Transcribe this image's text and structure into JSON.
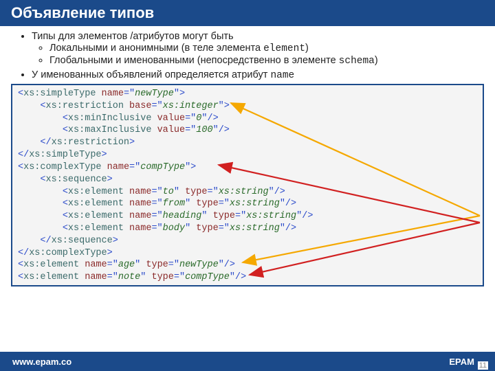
{
  "title": "Объявление типов",
  "bullets": {
    "item1": "Типы для элементов /атрибутов могут быть",
    "sub1": "Локальными и анонимными (в теле элемента ",
    "sub1_mono": "element",
    "sub1_end": ")",
    "sub2": "Глобальными и именованными (непосредственно в элементе ",
    "sub2_mono": "schema",
    "sub2_end": ")",
    "item2_a": "У именованных объявлений определяется атрибут ",
    "item2_mono": "name"
  },
  "code": [
    [
      {
        "t": "<",
        "c": "punct"
      },
      {
        "t": "xs:simpleType",
        "c": "tag"
      },
      {
        "t": " "
      },
      {
        "t": "name",
        "c": "attr"
      },
      {
        "t": "=\"",
        "c": "punct"
      },
      {
        "t": "newType",
        "c": "val"
      },
      {
        "t": "\">",
        "c": "punct"
      }
    ],
    [
      {
        "t": "    "
      },
      {
        "t": "<",
        "c": "punct"
      },
      {
        "t": "xs:restriction",
        "c": "tag"
      },
      {
        "t": " "
      },
      {
        "t": "base",
        "c": "attr"
      },
      {
        "t": "=\"",
        "c": "punct"
      },
      {
        "t": "xs:integer",
        "c": "val"
      },
      {
        "t": "\">",
        "c": "punct"
      }
    ],
    [
      {
        "t": "        "
      },
      {
        "t": "<",
        "c": "punct"
      },
      {
        "t": "xs:minInclusive",
        "c": "tag"
      },
      {
        "t": " "
      },
      {
        "t": "value",
        "c": "attr"
      },
      {
        "t": "=\"",
        "c": "punct"
      },
      {
        "t": "0",
        "c": "val"
      },
      {
        "t": "\"/>",
        "c": "punct"
      }
    ],
    [
      {
        "t": "        "
      },
      {
        "t": "<",
        "c": "punct"
      },
      {
        "t": "xs:maxInclusive",
        "c": "tag"
      },
      {
        "t": " "
      },
      {
        "t": "value",
        "c": "attr"
      },
      {
        "t": "=\"",
        "c": "punct"
      },
      {
        "t": "100",
        "c": "val"
      },
      {
        "t": "\"/>",
        "c": "punct"
      }
    ],
    [
      {
        "t": "    "
      },
      {
        "t": "</",
        "c": "punct"
      },
      {
        "t": "xs:restriction",
        "c": "tag"
      },
      {
        "t": ">",
        "c": "punct"
      }
    ],
    [
      {
        "t": "</",
        "c": "punct"
      },
      {
        "t": "xs:simpleType",
        "c": "tag"
      },
      {
        "t": ">",
        "c": "punct"
      }
    ],
    [
      {
        "t": "<",
        "c": "punct"
      },
      {
        "t": "xs:complexType",
        "c": "tag"
      },
      {
        "t": " "
      },
      {
        "t": "name",
        "c": "attr"
      },
      {
        "t": "=\"",
        "c": "punct"
      },
      {
        "t": "compType",
        "c": "val"
      },
      {
        "t": "\">",
        "c": "punct"
      }
    ],
    [
      {
        "t": "    "
      },
      {
        "t": "<",
        "c": "punct"
      },
      {
        "t": "xs:sequence",
        "c": "tag"
      },
      {
        "t": ">",
        "c": "punct"
      }
    ],
    [
      {
        "t": "        "
      },
      {
        "t": "<",
        "c": "punct"
      },
      {
        "t": "xs:element",
        "c": "tag"
      },
      {
        "t": " "
      },
      {
        "t": "name",
        "c": "attr"
      },
      {
        "t": "=\"",
        "c": "punct"
      },
      {
        "t": "to",
        "c": "val"
      },
      {
        "t": "\"",
        "c": "punct"
      },
      {
        "t": " "
      },
      {
        "t": "type",
        "c": "attr"
      },
      {
        "t": "=\"",
        "c": "punct"
      },
      {
        "t": "xs:string",
        "c": "val"
      },
      {
        "t": "\"/>",
        "c": "punct"
      }
    ],
    [
      {
        "t": "        "
      },
      {
        "t": "<",
        "c": "punct"
      },
      {
        "t": "xs:element",
        "c": "tag"
      },
      {
        "t": " "
      },
      {
        "t": "name",
        "c": "attr"
      },
      {
        "t": "=\"",
        "c": "punct"
      },
      {
        "t": "from",
        "c": "val"
      },
      {
        "t": "\"",
        "c": "punct"
      },
      {
        "t": " "
      },
      {
        "t": "type",
        "c": "attr"
      },
      {
        "t": "=\"",
        "c": "punct"
      },
      {
        "t": "xs:string",
        "c": "val"
      },
      {
        "t": "\"/>",
        "c": "punct"
      }
    ],
    [
      {
        "t": "        "
      },
      {
        "t": "<",
        "c": "punct"
      },
      {
        "t": "xs:element",
        "c": "tag"
      },
      {
        "t": " "
      },
      {
        "t": "name",
        "c": "attr"
      },
      {
        "t": "=\"",
        "c": "punct"
      },
      {
        "t": "heading",
        "c": "val"
      },
      {
        "t": "\"",
        "c": "punct"
      },
      {
        "t": " "
      },
      {
        "t": "type",
        "c": "attr"
      },
      {
        "t": "=\"",
        "c": "punct"
      },
      {
        "t": "xs:string",
        "c": "val"
      },
      {
        "t": "\"/>",
        "c": "punct"
      }
    ],
    [
      {
        "t": "        "
      },
      {
        "t": "<",
        "c": "punct"
      },
      {
        "t": "xs:element",
        "c": "tag"
      },
      {
        "t": " "
      },
      {
        "t": "name",
        "c": "attr"
      },
      {
        "t": "=\"",
        "c": "punct"
      },
      {
        "t": "body",
        "c": "val"
      },
      {
        "t": "\"",
        "c": "punct"
      },
      {
        "t": " "
      },
      {
        "t": "type",
        "c": "attr"
      },
      {
        "t": "=\"",
        "c": "punct"
      },
      {
        "t": "xs:string",
        "c": "val"
      },
      {
        "t": "\"/>",
        "c": "punct"
      }
    ],
    [
      {
        "t": "    "
      },
      {
        "t": "</",
        "c": "punct"
      },
      {
        "t": "xs:sequence",
        "c": "tag"
      },
      {
        "t": ">",
        "c": "punct"
      }
    ],
    [
      {
        "t": "</",
        "c": "punct"
      },
      {
        "t": "xs:complexType",
        "c": "tag"
      },
      {
        "t": ">",
        "c": "punct"
      }
    ],
    [
      {
        "t": "<",
        "c": "punct"
      },
      {
        "t": "xs:element",
        "c": "tag"
      },
      {
        "t": " "
      },
      {
        "t": "name",
        "c": "attr"
      },
      {
        "t": "=\"",
        "c": "punct"
      },
      {
        "t": "age",
        "c": "val"
      },
      {
        "t": "\"",
        "c": "punct"
      },
      {
        "t": " "
      },
      {
        "t": "type",
        "c": "attr"
      },
      {
        "t": "=\"",
        "c": "punct"
      },
      {
        "t": "newType",
        "c": "val"
      },
      {
        "t": "\"/>",
        "c": "punct"
      }
    ],
    [
      {
        "t": "<",
        "c": "punct"
      },
      {
        "t": "xs:element",
        "c": "tag"
      },
      {
        "t": " "
      },
      {
        "t": "name",
        "c": "attr"
      },
      {
        "t": "=\"",
        "c": "punct"
      },
      {
        "t": "note",
        "c": "val"
      },
      {
        "t": "\"",
        "c": "punct"
      },
      {
        "t": " "
      },
      {
        "t": "type",
        "c": "attr"
      },
      {
        "t": "=\"",
        "c": "punct"
      },
      {
        "t": "compType",
        "c": "val"
      },
      {
        "t": "\"/>",
        "c": "punct"
      }
    ]
  ],
  "footer": {
    "left": "www.epam.co",
    "right": "EPAM"
  },
  "page": "11"
}
